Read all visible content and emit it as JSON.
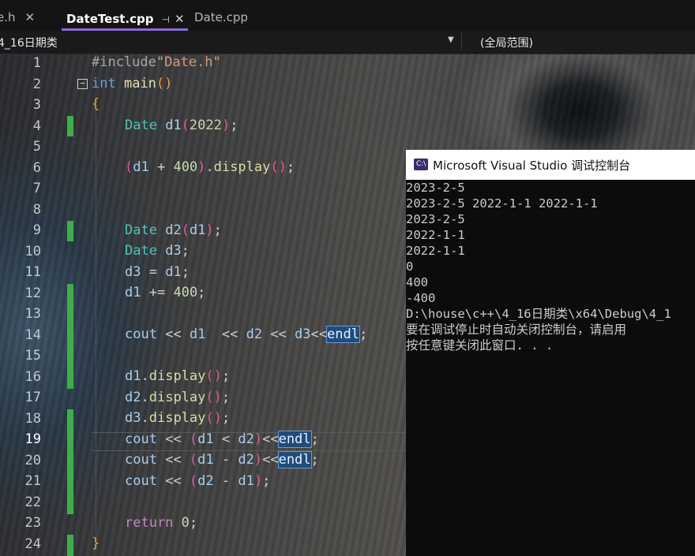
{
  "tabs": {
    "date_h": "e.h",
    "active": "DateTest.cpp",
    "pin_glyph": "⊣",
    "close_glyph": "✕",
    "date_cpp": "Date.cpp"
  },
  "navbar": {
    "scope": "4_16日期类",
    "global_scope": "(全局范围)"
  },
  "line_numbers": [
    "1",
    "2",
    "3",
    "4",
    "5",
    "6",
    "7",
    "8",
    "9",
    "10",
    "11",
    "12",
    "13",
    "14",
    "15",
    "16",
    "17",
    "18",
    "19",
    "20",
    "21",
    "22",
    "23",
    "24"
  ],
  "code": {
    "l1": {
      "pp": "#include",
      "str": "\"Date.h\""
    },
    "l2": {
      "kw": "int",
      "fn": " main",
      "open": "(",
      "close": ")"
    },
    "l3": {
      "brace": "{"
    },
    "l4": {
      "type": "Date",
      "id": " d1",
      "open": "(",
      "num": "2022",
      "close": ")",
      "semi": ";"
    },
    "l6": {
      "open": "(",
      "id": "d1",
      "op": " + ",
      "num": "400",
      "close": ")",
      "dot": ".",
      "meth": "display",
      "call": "()",
      "semi": ";"
    },
    "l9": {
      "type": "Date",
      "id": " d2",
      "open": "(",
      "arg": "d1",
      "close": ")",
      "semi": ";"
    },
    "l10": {
      "type": "Date",
      "id": " d3",
      "semi": ";"
    },
    "l11": {
      "id": "d3",
      "op": " = ",
      "id2": "d1",
      "semi": ";"
    },
    "l12": {
      "id": "d1",
      "op": " += ",
      "num": "400",
      "semi": ";"
    },
    "l14": {
      "id": "cout",
      "op1": " << ",
      "a": "d1",
      "op2": "  << ",
      "b": "d2",
      "op3": " << ",
      "c": "d3",
      "op4": "<<",
      "endl": "endl",
      "semi": ";"
    },
    "l16": {
      "id": "d1",
      "dot": ".",
      "meth": "display",
      "call": "()",
      "semi": ";"
    },
    "l17": {
      "id": "d2",
      "dot": ".",
      "meth": "display",
      "call": "()",
      "semi": ";"
    },
    "l18": {
      "id": "d3",
      "dot": ".",
      "meth": "display",
      "call": "()",
      "semi": ";"
    },
    "l19": {
      "id": "cout",
      "op1": " << ",
      "open": "(",
      "a": "d1",
      "op": " < ",
      "b": "d2",
      "close": ")",
      "op2": "<<",
      "endl": "endl",
      "semi": ";"
    },
    "l20": {
      "id": "cout",
      "op1": " << ",
      "open": "(",
      "a": "d1",
      "op": " - ",
      "b": "d2",
      "close": ")",
      "op2": "<<",
      "endl": "endl",
      "semi": ";"
    },
    "l21": {
      "id": "cout",
      "op1": " << ",
      "open": "(",
      "a": "d2",
      "op": " - ",
      "b": "d1",
      "close": ")",
      "semi": ";"
    },
    "l23": {
      "kw": "return",
      "num": " 0",
      "semi": ";"
    },
    "l24": {
      "brace": "}"
    }
  },
  "console": {
    "icon_text": "C:\\",
    "title": "Microsoft Visual Studio 调试控制台",
    "lines": [
      "2023-2-5",
      "2023-2-5 2022-1-1 2022-1-1",
      "2023-2-5",
      "2022-1-1",
      "2022-1-1",
      "0",
      "400",
      "-400",
      "D:\\house\\c++\\4_16日期类\\x64\\Debug\\4_1",
      "要在调试停止时自动关闭控制台，请启用",
      "按任意键关闭此窗口. . ."
    ]
  }
}
